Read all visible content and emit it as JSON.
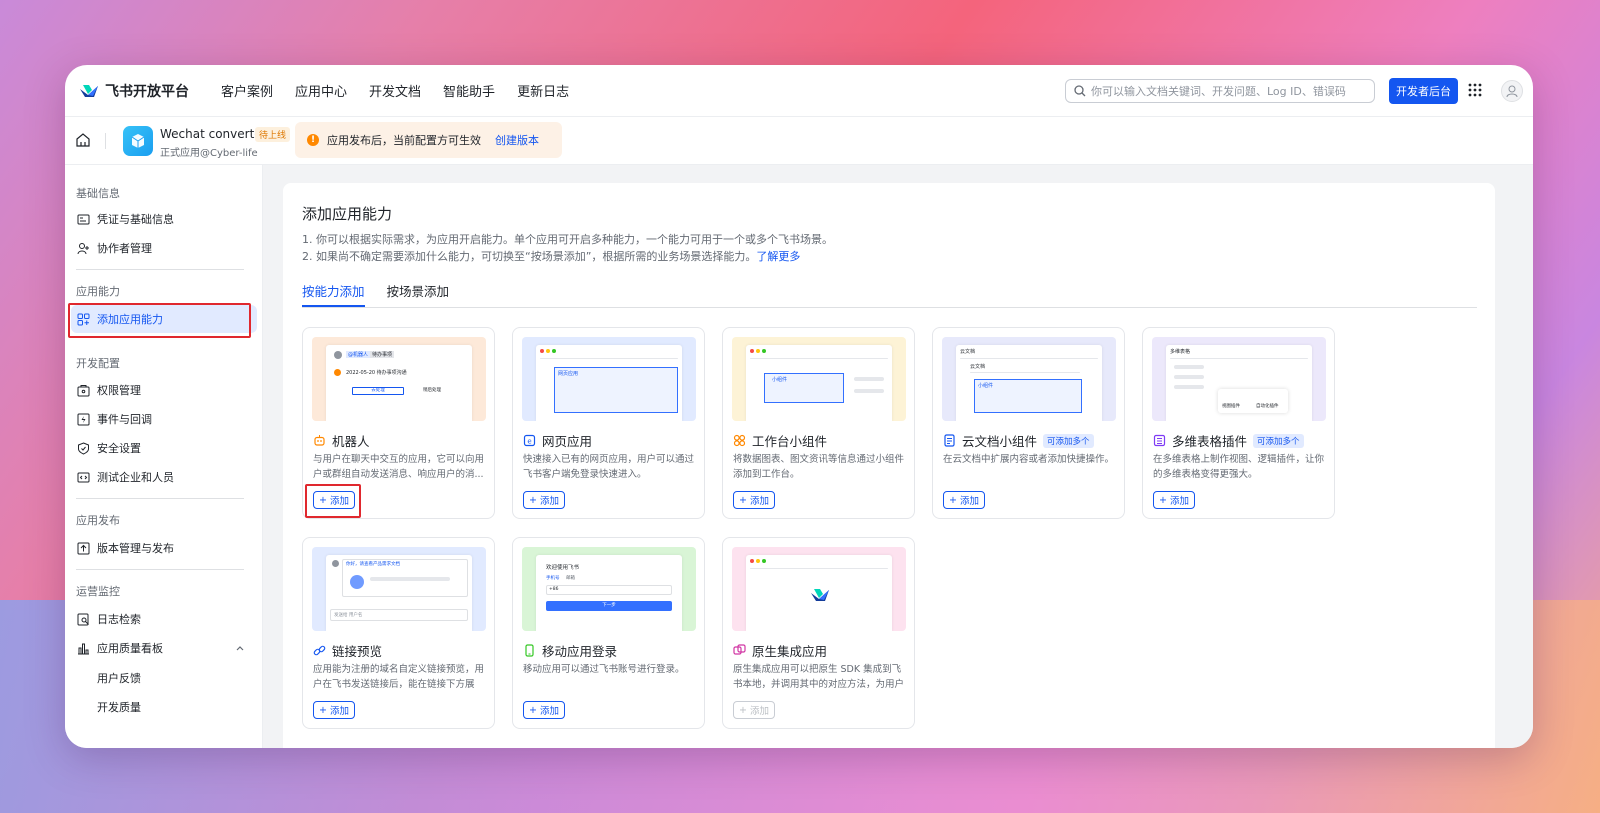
{
  "topbar": {
    "logo_text": "飞书开放平台",
    "nav": [
      "客户案例",
      "应用中心",
      "开发文档",
      "智能助手",
      "更新日志"
    ],
    "search_placeholder": "你可以输入文档关键词、开发问题、Log ID、错误码",
    "dev_button": "开发者后台"
  },
  "appbar": {
    "app_name": "Wechat converter",
    "app_status": "待上线",
    "app_sub": "正式应用@Cyber-life",
    "notice_text": "应用发布后，当前配置方可生效",
    "notice_link": "创建版本"
  },
  "sidebar": {
    "sections": {
      "basic": "基础信息",
      "capability": "应用能力",
      "dev": "开发配置",
      "release": "应用发布",
      "ops": "运营监控"
    },
    "items": {
      "credentials": "凭证与基础信息",
      "collaborators": "协作者管理",
      "add_capability": "添加应用能力",
      "permissions": "权限管理",
      "events": "事件与回调",
      "security": "安全设置",
      "test_company": "测试企业和人员",
      "versions": "版本管理与发布",
      "log_search": "日志检索",
      "quality_board": "应用质量看板",
      "user_feedback": "用户反馈",
      "dev_quality": "开发质量"
    }
  },
  "main": {
    "title": "添加应用能力",
    "desc1": "1. 你可以根据实际需求，为应用开启能力。单个应用可开启多种能力，一个能力可用于一个或多个飞书场景。",
    "desc2": "2. 如果尚不确定需要添加什么能力，可切换至“按场景添加”，根据所需的业务场景选择能力。",
    "learn_more": "了解更多",
    "tabs": [
      "按能力添加",
      "按场景添加"
    ],
    "add_label": "添加",
    "multi_label": "可添加多个",
    "cards": [
      {
        "title": "机器人",
        "desc": "与用户在聊天中交互的应用，它可以向用户或群组自动发送消息、响应用户的消...",
        "icon": "robot-icon"
      },
      {
        "title": "网页应用",
        "desc": "快速接入已有的网页应用，用户可以通过飞书客户端免登录快速进入。",
        "icon": "web-app-icon"
      },
      {
        "title": "工作台小组件",
        "desc": "将数据图表、图文资讯等信息通过小组件添加到工作台。",
        "icon": "widget-icon"
      },
      {
        "title": "云文档小组件",
        "desc": "在云文档中扩展内容或者添加快捷操作。",
        "icon": "doc-widget-icon"
      },
      {
        "title": "多维表格插件",
        "desc": "在多维表格上制作视图、逻辑插件，让你的多维表格变得更强大。",
        "icon": "bitable-plugin-icon"
      },
      {
        "title": "链接预览",
        "desc": "应用能为注册的域名自定义链接预览，用户在飞书发送链接后，能在链接下方展示...",
        "icon": "link-icon"
      },
      {
        "title": "移动应用登录",
        "desc": "移动应用可以通过飞书账号进行登录。",
        "icon": "mobile-icon"
      },
      {
        "title": "原生集成应用",
        "desc": "原生集成应用可以把原生 SDK 集成到飞书本地，并调用其中的对应方法，为用户提...",
        "icon": "native-icon"
      }
    ],
    "previews": {
      "bot_tag": "@机器人",
      "bot_tag2": "待办事项",
      "bot_date": "2022-05-20 待办事项沟通",
      "bot_btn1": "去处理",
      "bot_btn2": "稍后处理",
      "web_tab": "网页应用",
      "widget_item": "小组件",
      "doc_title": "云文档",
      "doc_sub": "云文档",
      "doc_item": "小组件",
      "bitable_title": "多维表格",
      "bitable_view": "视图插件",
      "bitable_auto": "自动化插件",
      "mobile_title": "欢迎使用飞书",
      "mobile_tab1": "手机号",
      "mobile_tab2": "邮箱",
      "mobile_code": "+86",
      "mobile_btn": "下一步",
      "link_msg": "你好，请查看产品需求文档",
      "link_input": "发送给 用户名"
    }
  },
  "colors": {
    "accent": "#1456f0",
    "highlight_box": "#e0282e",
    "notice_bg": "#fdf1e6",
    "warning": "#ff8800"
  }
}
